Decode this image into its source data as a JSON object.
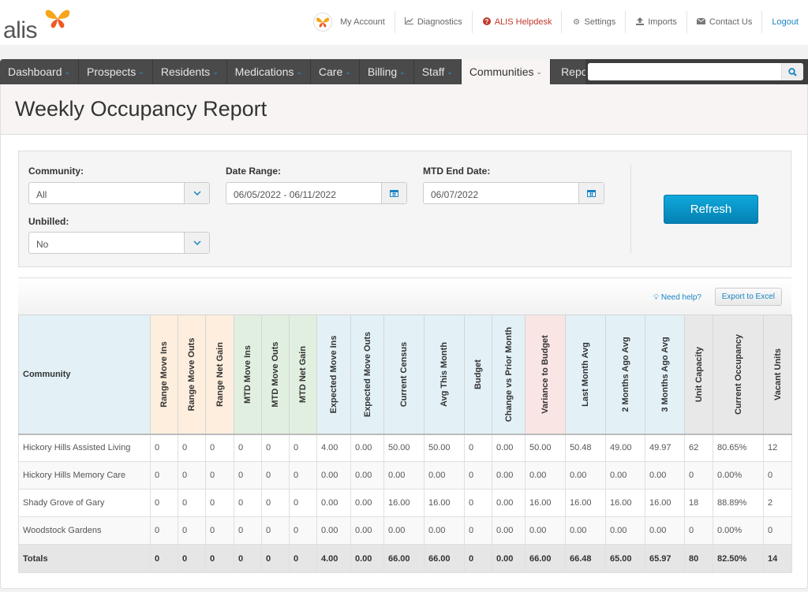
{
  "brand": {
    "name": "alis",
    "colors": {
      "accent": "#0a93c8",
      "butterfly_orange": "#f7a51c",
      "butterfly_red": "#ec5a24"
    }
  },
  "header": {
    "links": [
      {
        "icon": "avatar-icon",
        "label": "My Account"
      },
      {
        "icon": "chart-icon",
        "label": "Diagnostics"
      },
      {
        "icon": "question-circle-icon",
        "label": "ALIS Helpdesk"
      },
      {
        "icon": "gear-icon",
        "label": "Settings"
      },
      {
        "icon": "upload-icon",
        "label": "Imports"
      },
      {
        "icon": "envelope-icon",
        "label": "Contact Us"
      },
      {
        "icon": "",
        "label": "Logout"
      }
    ]
  },
  "nav": {
    "items": [
      {
        "label": "Dashboard",
        "dropdown": true,
        "active": false
      },
      {
        "label": "Prospects",
        "dropdown": true,
        "active": false
      },
      {
        "label": "Residents",
        "dropdown": true,
        "active": false
      },
      {
        "label": "Medications",
        "dropdown": true,
        "active": false
      },
      {
        "label": "Care",
        "dropdown": true,
        "active": false
      },
      {
        "label": "Billing",
        "dropdown": true,
        "active": false
      },
      {
        "label": "Staff",
        "dropdown": true,
        "active": false
      },
      {
        "label": "Communities",
        "dropdown": true,
        "active": true
      },
      {
        "label": "Reports",
        "dropdown": false,
        "active": false
      }
    ],
    "search": {
      "value": "",
      "placeholder": ""
    }
  },
  "page": {
    "title": "Weekly Occupancy Report"
  },
  "filters": {
    "community": {
      "label": "Community:",
      "value": "All"
    },
    "unbilled": {
      "label": "Unbilled:",
      "value": "No"
    },
    "date_range": {
      "label": "Date Range:",
      "value": "06/05/2022 - 06/11/2022"
    },
    "mtd_end_date": {
      "label": "MTD End Date:",
      "value": "06/07/2022"
    },
    "refresh_label": "Refresh"
  },
  "toolbar": {
    "need_help": "Need help?",
    "export": "Export to Excel"
  },
  "table": {
    "columns": [
      {
        "label": "Community",
        "group": "blue"
      },
      {
        "label": "Range Move Ins",
        "group": "orange"
      },
      {
        "label": "Range Move Outs",
        "group": "orange"
      },
      {
        "label": "Range Net Gain",
        "group": "orange"
      },
      {
        "label": "MTD Move Ins",
        "group": "green"
      },
      {
        "label": "MTD Move Outs",
        "group": "green"
      },
      {
        "label": "MTD Net Gain",
        "group": "green"
      },
      {
        "label": "Expected Move Ins",
        "group": "blue"
      },
      {
        "label": "Expected Move Outs",
        "group": "blue"
      },
      {
        "label": "Current Census",
        "group": "blue"
      },
      {
        "label": "Avg This Month",
        "group": "blue"
      },
      {
        "label": "Budget",
        "group": "blue"
      },
      {
        "label": "Change vs Prior Month",
        "group": "blue"
      },
      {
        "label": "Variance to Budget",
        "group": "red"
      },
      {
        "label": "Last Month Avg",
        "group": "blue"
      },
      {
        "label": "2 Months Ago Avg",
        "group": "blue"
      },
      {
        "label": "3 Months Ago Avg",
        "group": "blue"
      },
      {
        "label": "Unit Capacity",
        "group": "gray"
      },
      {
        "label": "Current Occupancy",
        "group": "gray"
      },
      {
        "label": "Vacant Units",
        "group": "gray"
      }
    ],
    "rows": [
      [
        "Hickory Hills Assisted Living",
        "0",
        "0",
        "0",
        "0",
        "0",
        "0",
        "4.00",
        "0.00",
        "50.00",
        "50.00",
        "0",
        "0.00",
        "50.00",
        "50.48",
        "49.00",
        "49.97",
        "62",
        "80.65%",
        "12"
      ],
      [
        "Hickory Hills Memory Care",
        "0",
        "0",
        "0",
        "0",
        "0",
        "0",
        "0.00",
        "0.00",
        "0.00",
        "0.00",
        "0",
        "0.00",
        "0.00",
        "0.00",
        "0.00",
        "0.00",
        "0",
        "0.00%",
        "0"
      ],
      [
        "Shady Grove of Gary",
        "0",
        "0",
        "0",
        "0",
        "0",
        "0",
        "0.00",
        "0.00",
        "16.00",
        "16.00",
        "0",
        "0.00",
        "16.00",
        "16.00",
        "16.00",
        "16.00",
        "18",
        "88.89%",
        "2"
      ],
      [
        "Woodstock Gardens",
        "0",
        "0",
        "0",
        "0",
        "0",
        "0",
        "0.00",
        "0.00",
        "0.00",
        "0.00",
        "0",
        "0.00",
        "0.00",
        "0.00",
        "0.00",
        "0.00",
        "0",
        "0.00%",
        "0"
      ]
    ],
    "totals": [
      "Totals",
      "0",
      "0",
      "0",
      "0",
      "0",
      "0",
      "4.00",
      "0.00",
      "66.00",
      "66.00",
      "0",
      "0.00",
      "66.00",
      "66.48",
      "65.00",
      "65.97",
      "80",
      "82.50%",
      "14"
    ]
  }
}
